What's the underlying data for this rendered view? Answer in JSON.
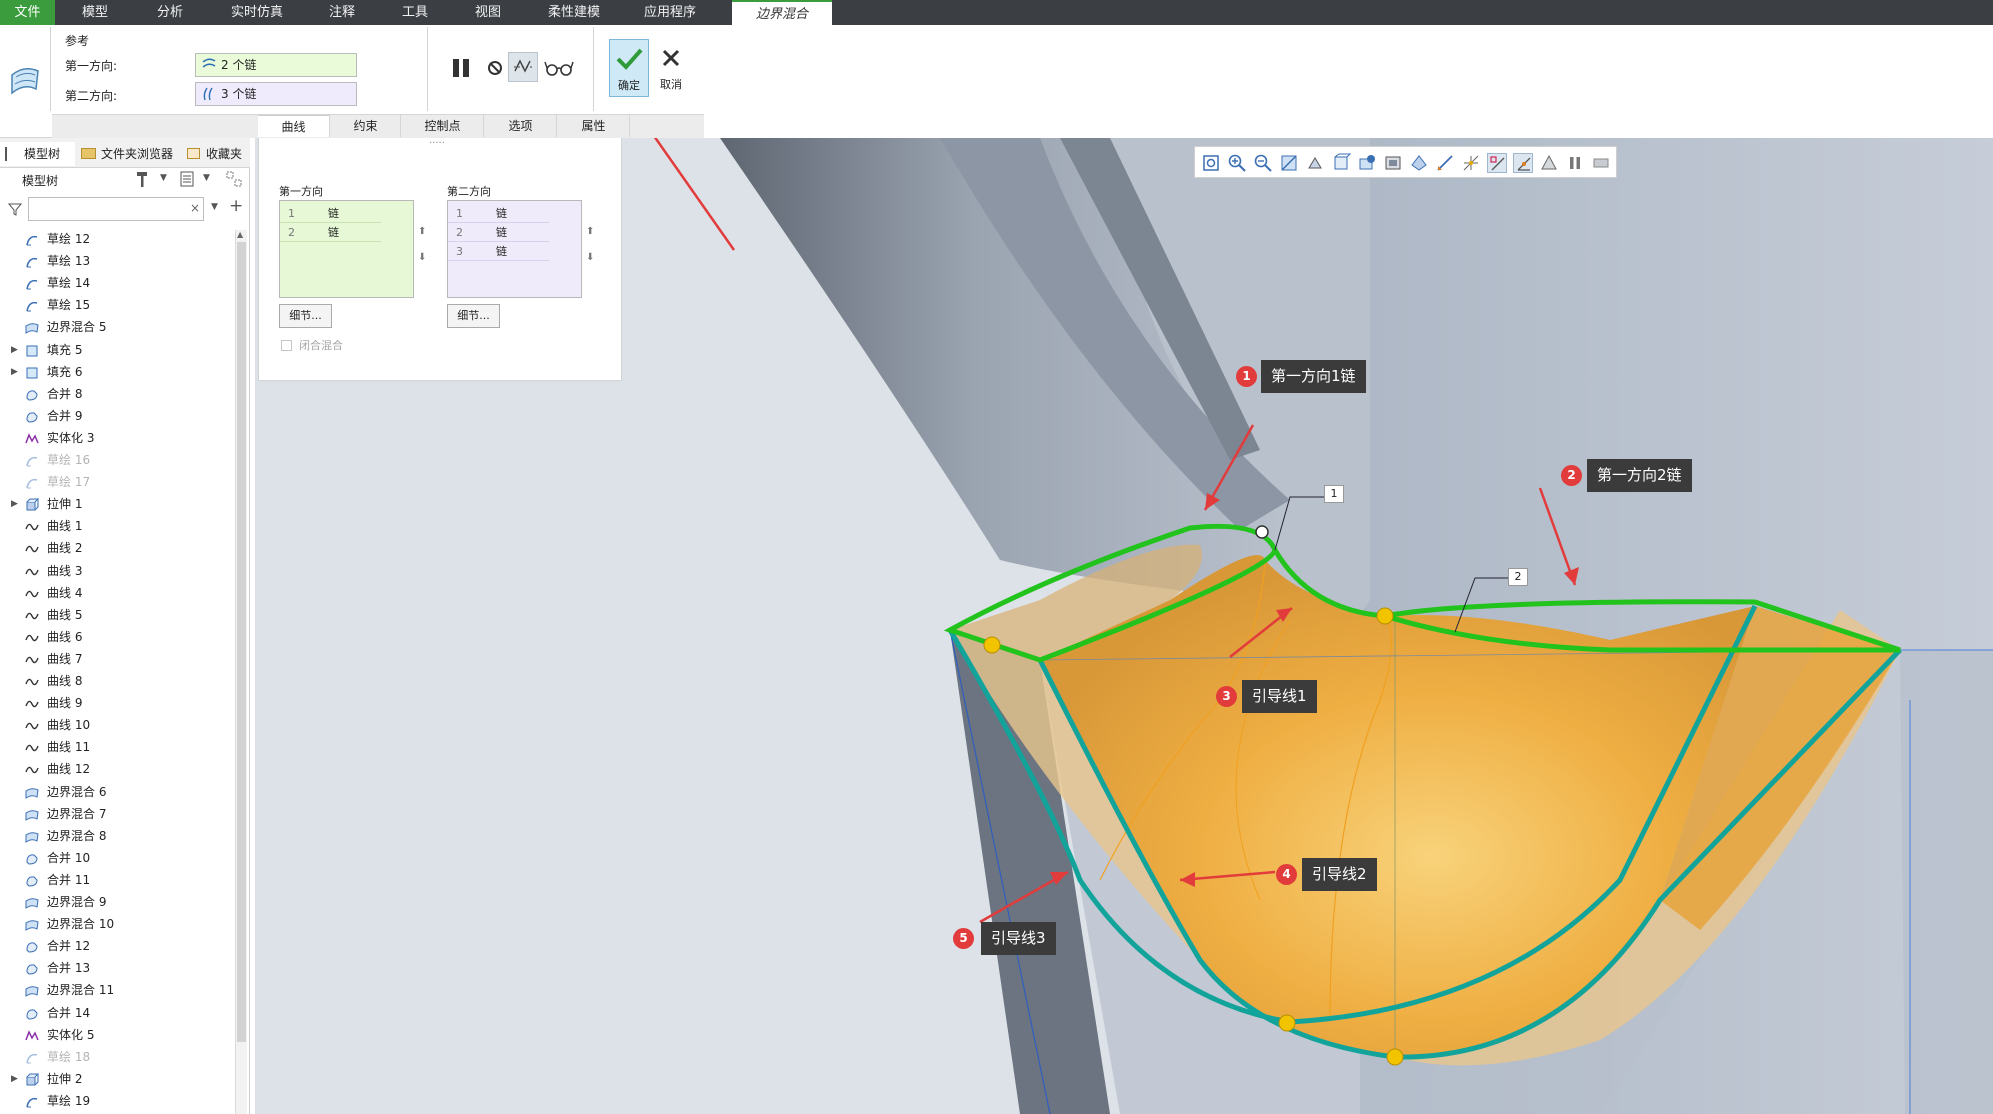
{
  "menubar": {
    "items": [
      "文件",
      "模型",
      "分析",
      "实时仿真",
      "注释",
      "工具",
      "视图",
      "柔性建模",
      "应用程序"
    ],
    "context_tab": "边界混合"
  },
  "ribbon": {
    "ref_title": "参考",
    "dir1_label": "第一方向:",
    "dir2_label": "第二方向:",
    "dir1_value": "2 个链",
    "dir2_value": "3 个链",
    "ok_label": "确定",
    "cancel_label": "取消",
    "subtabs": [
      "曲线",
      "约束",
      "控制点",
      "选项",
      "属性"
    ]
  },
  "tree": {
    "tabs": [
      "模型树",
      "文件夹浏览器",
      "收藏夹"
    ],
    "header": "模型树",
    "search_placeholder": "",
    "items": [
      {
        "label": "草绘 12",
        "icon": "sketch-icon",
        "dim": false,
        "arrow": false
      },
      {
        "label": "草绘 13",
        "icon": "sketch-icon",
        "dim": false,
        "arrow": false
      },
      {
        "label": "草绘 14",
        "icon": "sketch-icon",
        "dim": false,
        "arrow": false
      },
      {
        "label": "草绘 15",
        "icon": "sketch-icon",
        "dim": false,
        "arrow": false
      },
      {
        "label": "边界混合 5",
        "icon": "boundary-blend-icon",
        "dim": false,
        "arrow": false
      },
      {
        "label": "填充 5",
        "icon": "fill-icon",
        "dim": false,
        "arrow": true
      },
      {
        "label": "填充 6",
        "icon": "fill-icon",
        "dim": false,
        "arrow": true
      },
      {
        "label": "合并 8",
        "icon": "merge-icon",
        "dim": false,
        "arrow": false
      },
      {
        "label": "合并 9",
        "icon": "merge-icon",
        "dim": false,
        "arrow": false
      },
      {
        "label": "实体化 3",
        "icon": "solidify-icon",
        "dim": false,
        "arrow": false
      },
      {
        "label": "草绘 16",
        "icon": "sketch-icon",
        "dim": true,
        "arrow": false
      },
      {
        "label": "草绘 17",
        "icon": "sketch-icon",
        "dim": true,
        "arrow": false
      },
      {
        "label": "拉伸 1",
        "icon": "extrude-icon",
        "dim": false,
        "arrow": true
      },
      {
        "label": "曲线 1",
        "icon": "curve-icon",
        "dim": false,
        "arrow": false
      },
      {
        "label": "曲线 2",
        "icon": "curve-icon",
        "dim": false,
        "arrow": false
      },
      {
        "label": "曲线 3",
        "icon": "curve-icon",
        "dim": false,
        "arrow": false
      },
      {
        "label": "曲线 4",
        "icon": "curve-icon",
        "dim": false,
        "arrow": false
      },
      {
        "label": "曲线 5",
        "icon": "curve-icon",
        "dim": false,
        "arrow": false
      },
      {
        "label": "曲线 6",
        "icon": "curve-icon",
        "dim": false,
        "arrow": false
      },
      {
        "label": "曲线 7",
        "icon": "curve-icon",
        "dim": false,
        "arrow": false
      },
      {
        "label": "曲线 8",
        "icon": "curve-icon",
        "dim": false,
        "arrow": false
      },
      {
        "label": "曲线 9",
        "icon": "curve-icon",
        "dim": false,
        "arrow": false
      },
      {
        "label": "曲线 10",
        "icon": "curve-icon",
        "dim": false,
        "arrow": false
      },
      {
        "label": "曲线 11",
        "icon": "curve-icon",
        "dim": false,
        "arrow": false
      },
      {
        "label": "曲线 12",
        "icon": "curve-icon",
        "dim": false,
        "arrow": false
      },
      {
        "label": "边界混合 6",
        "icon": "boundary-blend-icon",
        "dim": false,
        "arrow": false
      },
      {
        "label": "边界混合 7",
        "icon": "boundary-blend-icon",
        "dim": false,
        "arrow": false
      },
      {
        "label": "边界混合 8",
        "icon": "boundary-blend-icon",
        "dim": false,
        "arrow": false
      },
      {
        "label": "合并 10",
        "icon": "merge-icon",
        "dim": false,
        "arrow": false
      },
      {
        "label": "合并 11",
        "icon": "merge-icon",
        "dim": false,
        "arrow": false
      },
      {
        "label": "边界混合 9",
        "icon": "boundary-blend-icon",
        "dim": false,
        "arrow": false
      },
      {
        "label": "边界混合 10",
        "icon": "boundary-blend-icon",
        "dim": false,
        "arrow": false
      },
      {
        "label": "合并 12",
        "icon": "merge-icon",
        "dim": false,
        "arrow": false
      },
      {
        "label": "合并 13",
        "icon": "merge-icon",
        "dim": false,
        "arrow": false
      },
      {
        "label": "边界混合 11",
        "icon": "boundary-blend-icon",
        "dim": false,
        "arrow": false
      },
      {
        "label": "合并 14",
        "icon": "merge-icon",
        "dim": false,
        "arrow": false
      },
      {
        "label": "实体化 5",
        "icon": "solidify-icon",
        "dim": false,
        "arrow": false
      },
      {
        "label": "草绘 18",
        "icon": "sketch-icon",
        "dim": true,
        "arrow": false
      },
      {
        "label": "拉伸 2",
        "icon": "extrude-icon",
        "dim": false,
        "arrow": true
      },
      {
        "label": "草绘 19",
        "icon": "sketch-icon",
        "dim": false,
        "arrow": false
      }
    ]
  },
  "panel": {
    "dir1_title": "第一方向",
    "dir2_title": "第二方向",
    "dir1_rows": [
      {
        "n": "1",
        "c": "链"
      },
      {
        "n": "2",
        "c": "链"
      }
    ],
    "dir2_rows": [
      {
        "n": "1",
        "c": "链"
      },
      {
        "n": "2",
        "c": "链"
      },
      {
        "n": "3",
        "c": "链"
      }
    ],
    "detail_label": "细节...",
    "closed_blend_label": "闭合混合"
  },
  "viewport": {
    "callouts": [
      {
        "num": "1",
        "text": "第一方向1链"
      },
      {
        "num": "2",
        "text": "第一方向2链"
      },
      {
        "num": "3",
        "text": "引导线1"
      },
      {
        "num": "4",
        "text": "引导线2"
      },
      {
        "num": "5",
        "text": "引导线3"
      }
    ],
    "tags": [
      "1",
      "2"
    ]
  },
  "colors": {
    "accent_green": "#3a9c3c",
    "chain_green": "#22c31c",
    "guide_teal": "#12a39a",
    "surface_orange": "#f1a83a",
    "callout_red": "#e23b3b"
  }
}
